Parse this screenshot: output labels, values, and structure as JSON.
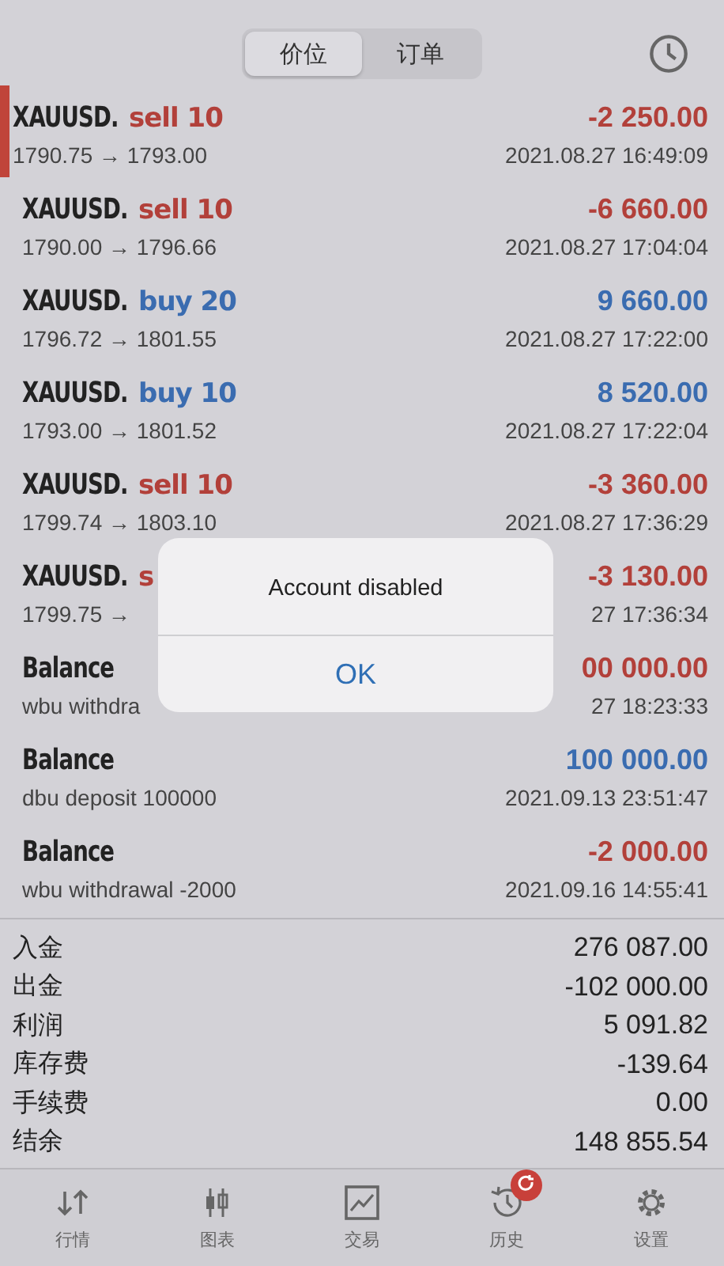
{
  "segments": [
    {
      "label": "价位",
      "selected": true
    },
    {
      "label": "订单",
      "selected": false
    }
  ],
  "rows": [
    {
      "symbol": "XAUUSD.",
      "action": "sell 10",
      "kind": "sell",
      "selected": true,
      "prices": "1790.75 → 1793.00",
      "profit": "-2 250.00",
      "loss": true,
      "time": "2021.08.27 16:49:09"
    },
    {
      "symbol": "XAUUSD.",
      "action": "sell 10",
      "kind": "sell",
      "selected": false,
      "prices": "1790.00 → 1796.66",
      "profit": "-6 660.00",
      "loss": true,
      "time": "2021.08.27 17:04:04"
    },
    {
      "symbol": "XAUUSD.",
      "action": "buy 20",
      "kind": "buy",
      "selected": false,
      "prices": "1796.72 → 1801.55",
      "profit": "9 660.00",
      "loss": false,
      "time": "2021.08.27 17:22:00"
    },
    {
      "symbol": "XAUUSD.",
      "action": "buy 10",
      "kind": "buy",
      "selected": false,
      "prices": "1793.00 → 1801.52",
      "profit": "8 520.00",
      "loss": false,
      "time": "2021.08.27 17:22:04"
    },
    {
      "symbol": "XAUUSD.",
      "action": "sell 10",
      "kind": "sell",
      "selected": false,
      "prices": "1799.74 → 1803.10",
      "profit": "-3 360.00",
      "loss": true,
      "time": "2021.08.27 17:36:29"
    },
    {
      "symbol": "XAUUSD.",
      "action": "s",
      "kind": "sell",
      "selected": false,
      "prices": "1799.75 →",
      "profit": "-3 130.00",
      "loss": true,
      "time": "27 17:36:34"
    },
    {
      "symbol": "Balance",
      "kind": "balance",
      "selected": false,
      "prices": "wbu withdra",
      "profit": "00 000.00",
      "loss": true,
      "time": "27 18:23:33"
    },
    {
      "symbol": "Balance",
      "kind": "balance",
      "selected": false,
      "prices": "dbu deposit 100000",
      "profit": "100 000.00",
      "loss": false,
      "time": "2021.09.13 23:51:47"
    },
    {
      "symbol": "Balance",
      "kind": "balance",
      "selected": false,
      "prices": "wbu withdrawal -2000",
      "profit": "-2 000.00",
      "loss": true,
      "time": "2021.09.16 14:55:41"
    }
  ],
  "summary": [
    {
      "label": "入金",
      "value": "276 087.00"
    },
    {
      "label": "出金",
      "value": "-102 000.00"
    },
    {
      "label": "利润",
      "value": "5 091.82"
    },
    {
      "label": "库存费",
      "value": "-139.64"
    },
    {
      "label": "手续费",
      "value": "0.00"
    },
    {
      "label": "结余",
      "value": "148 855.54"
    }
  ],
  "tabs": [
    {
      "label": "行情",
      "kind": "quotes"
    },
    {
      "label": "图表",
      "kind": "chart"
    },
    {
      "label": "交易",
      "kind": "trade"
    },
    {
      "label": "历史",
      "kind": "history",
      "badge": true
    },
    {
      "label": "设置",
      "kind": "settings"
    }
  ],
  "dialog": {
    "message": "Account disabled",
    "button": "OK"
  }
}
